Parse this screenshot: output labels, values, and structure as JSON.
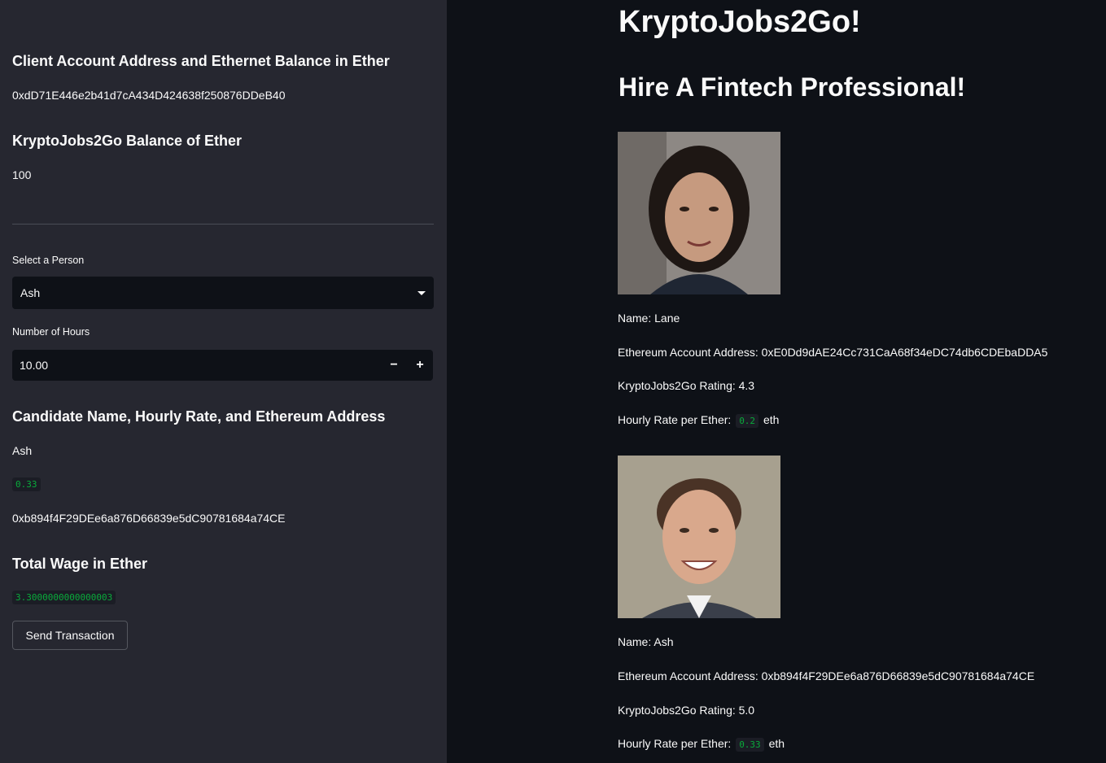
{
  "sidebar": {
    "client_heading": "Client Account Address and Ethernet Balance in Ether",
    "client_address": "0xdD71E446e2b41d7cA434D424638f250876DDeB40",
    "balance_heading": "KryptoJobs2Go Balance of Ether",
    "balance_value": "100",
    "select_label": "Select a Person",
    "select_value": "Ash",
    "hours_label": "Number of Hours",
    "hours_value": "10.00",
    "minus_label": "−",
    "plus_label": "+",
    "candidate_heading": "Candidate Name, Hourly Rate, and Ethereum Address",
    "candidate_name": "Ash",
    "candidate_rate": "0.33",
    "candidate_address": "0xb894f4F29DEe6a876D66839e5dC90781684a74CE",
    "wage_heading": "Total Wage in Ether",
    "wage_value": "3.3000000000000003",
    "send_button": "Send Transaction"
  },
  "main": {
    "title": "KryptoJobs2Go!",
    "subtitle": "Hire A Fintech Professional!",
    "candidates": [
      {
        "name_line": "Name: Lane",
        "address_line": "Ethereum Account Address: 0xE0Dd9dAE24Cc731CaA68f34eDC74db6CDEbaDDA5",
        "rating_line": "KryptoJobs2Go Rating: 4.3",
        "rate_prefix": "Hourly Rate per Ether:",
        "rate_value": "0.2",
        "rate_suffix": "eth"
      },
      {
        "name_line": "Name: Ash",
        "address_line": "Ethereum Account Address: 0xb894f4F29DEe6a876D66839e5dC90781684a74CE",
        "rating_line": "KryptoJobs2Go Rating: 5.0",
        "rate_prefix": "Hourly Rate per Ether:",
        "rate_value": "0.33",
        "rate_suffix": "eth"
      }
    ]
  },
  "colors": {
    "background": "#0e1117",
    "sidebar": "#262730",
    "code_text": "#09ab3b"
  }
}
